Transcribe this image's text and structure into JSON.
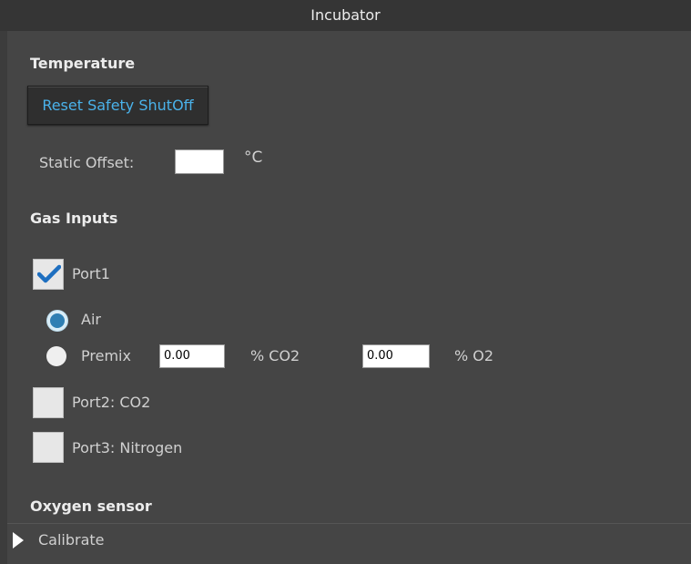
{
  "window": {
    "title": "Incubator"
  },
  "temperature": {
    "section_label": "Temperature",
    "reset_button_label": "Reset Safety ShutOff",
    "static_offset_label": "Static Offset:",
    "static_offset_value": "",
    "unit_label": "°C"
  },
  "gas_inputs": {
    "section_label": "Gas Inputs",
    "port1": {
      "label": "Port1",
      "checked": true,
      "air_label": "Air",
      "premix_label": "Premix",
      "selected_source": "Air",
      "co2_value": "0.00",
      "co2_unit": "% CO2",
      "o2_value": "0.00",
      "o2_unit": "% O2"
    },
    "port2": {
      "label": "Port2: CO2",
      "checked": false
    },
    "port3": {
      "label": "Port3: Nitrogen",
      "checked": false
    }
  },
  "oxygen_sensor": {
    "section_label": "Oxygen sensor",
    "calibrate_label": "Calibrate"
  },
  "colors": {
    "accent": "#4ab2ea",
    "radio_selected": "#2f7fb3",
    "checkmark": "#1e6fc0"
  },
  "icons": {
    "port1_check": "checkmark-icon",
    "calibrate_expander": "triangle-right-icon"
  }
}
